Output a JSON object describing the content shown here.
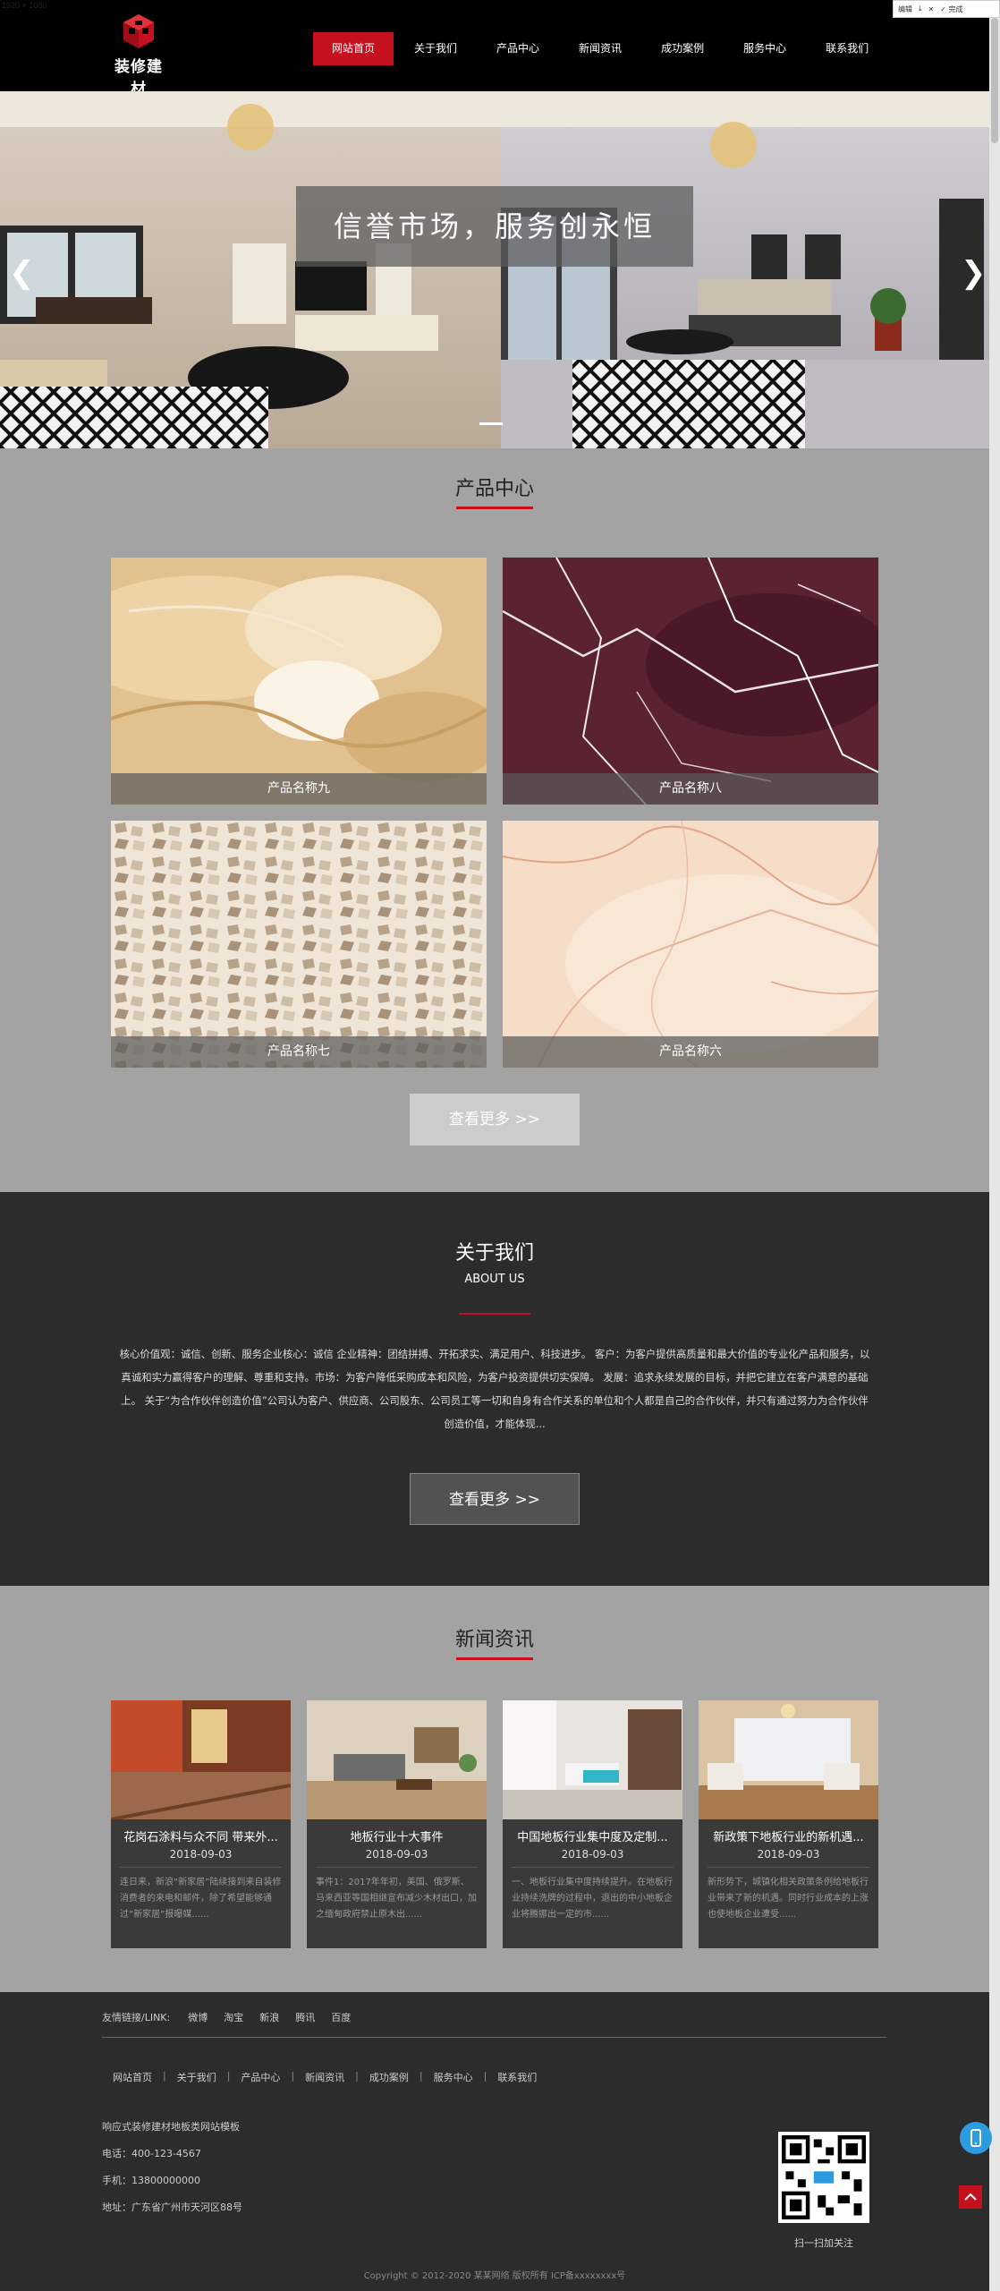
{
  "screenshot_note": "1920 × 1080",
  "overlay_toolbar": {
    "edit_label": "编辑",
    "done_label": "完成"
  },
  "header": {
    "logo_text": "装修建材",
    "nav": [
      "网站首页",
      "关于我们",
      "产品中心",
      "新闻资讯",
      "成功案例",
      "服务中心",
      "联系我们"
    ],
    "active_index": 0
  },
  "banner": {
    "caption": "信誉市场，服务创永恒",
    "prev_arrow": "❮",
    "next_arrow": "❯"
  },
  "products": {
    "title": "产品中心",
    "items": [
      {
        "name": "产品名称九",
        "texture": "beige-marble"
      },
      {
        "name": "产品名称八",
        "texture": "burgundy-marble"
      },
      {
        "name": "产品名称七",
        "texture": "terrazzo"
      },
      {
        "name": "产品名称六",
        "texture": "cream-veined-marble"
      }
    ],
    "more": "查看更多 >>"
  },
  "about": {
    "title": "关于我们",
    "subtitle": "ABOUT US",
    "text": "核心价值观：诚信、创新、服务企业核心：诚信 企业精神：团结拼搏、开拓求实、满足用户、科技进步。 客户：为客户提供高质量和最大价值的专业化产品和服务，以真诚和实力赢得客户的理解、尊重和支持。市场：为客户降低采购成本和风险，为客户投资提供切实保障。 发展：追求永续发展的目标，并把它建立在客户满意的基础上。 关于“为合作伙伴创造价值”公司认为客户、供应商、公司股东、公司员工等一切和自身有合作关系的单位和个人都是自己的合作伙伴，并只有通过努力为合作伙伴创造价值，才能体现...",
    "more": "查看更多 >>"
  },
  "news": {
    "title": "新闻资讯",
    "items": [
      {
        "title": "花岗石涂料与众不同 带来外...",
        "date": "2018-09-03",
        "excerpt": "连日来，新浪“新家居”陆续接到来自装修消费者的来电和邮件，除了希望能够通过“新家居”报曝媒......"
      },
      {
        "title": "地板行业十大事件",
        "date": "2018-09-03",
        "excerpt": "事件1：2017年年初，美国、俄罗斯、马来西亚等国相继宣布减少木材出口，加之缅甸政府禁止原木出......"
      },
      {
        "title": "中国地板行业集中度及定制...",
        "date": "2018-09-03",
        "excerpt": "一、地板行业集中度持续提升。在地板行业持续洗牌的过程中，退出的中小地板企业将腾挪出一定的市......"
      },
      {
        "title": "新政策下地板行业的新机遇...",
        "date": "2018-09-03",
        "excerpt": "新形势下，城镇化相关政策条例给地板行业带来了新的机遇。同时行业成本的上涨也使地板企业遭受......"
      }
    ]
  },
  "footer": {
    "links_label": "友情链接/LINK:",
    "links": [
      "微博",
      "淘宝",
      "新浪",
      "腾讯",
      "百度"
    ],
    "nav": [
      "网站首页",
      "关于我们",
      "产品中心",
      "新闻资讯",
      "成功案例",
      "服务中心",
      "联系我们"
    ],
    "company": "响应式装修建材地板类网站模板",
    "phone": "电话：400-123-4567",
    "mobile": "手机：13800000000",
    "address": "地址：广东省广州市天河区88号",
    "qr_label": "扫一扫加关注",
    "copyright": "Copyright © 2012-2020 某某网络 版权所有   ICP备xxxxxxxx号"
  },
  "colors": {
    "accent": "#c5101d",
    "header_bg": "#000000",
    "page_bg": "#a3a3a3",
    "dark_bg": "#2c2c2c"
  }
}
